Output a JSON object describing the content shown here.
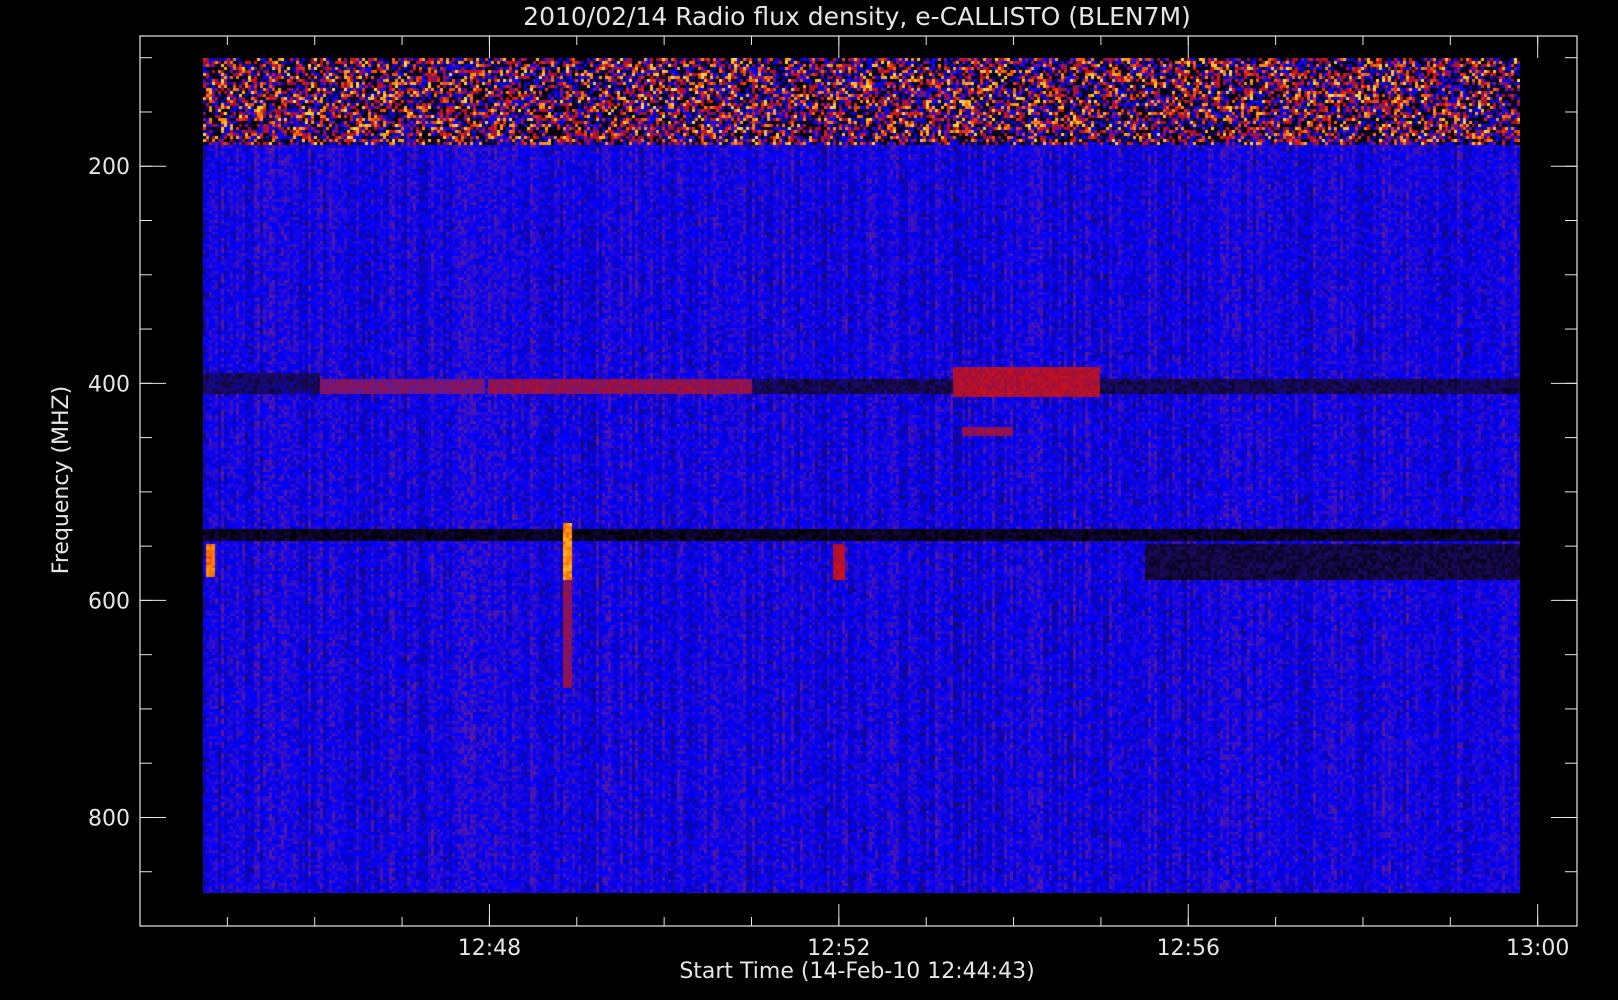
{
  "chart_data": {
    "type": "heatmap",
    "title": "2010/02/14  Radio flux density, e-CALLISTO (BLEN7M)",
    "xlabel": "Start Time (14-Feb-10 12:44:43)",
    "ylabel": "Frequency (MHZ)",
    "x_unit": "minutes after 12:00",
    "xlim": [
      44.0,
      60.45
    ],
    "ylim": [
      900,
      80
    ],
    "data_x_range": [
      44.72,
      59.8
    ],
    "data_y_range": [
      100,
      870
    ],
    "x_ticks": [
      {
        "value": 48,
        "label": "12:48"
      },
      {
        "value": 52,
        "label": "12:52"
      },
      {
        "value": 56,
        "label": "12:56"
      },
      {
        "value": 60,
        "label": "13:00"
      }
    ],
    "x_minor_step": 1,
    "y_ticks": [
      {
        "value": 200,
        "label": "200"
      },
      {
        "value": 400,
        "label": "400"
      },
      {
        "value": 600,
        "label": "600"
      },
      {
        "value": 800,
        "label": "800"
      }
    ],
    "y_minor_step": 50,
    "colormap": [
      "#000000",
      "#1a0a5a",
      "#0000ff",
      "#5a1aa0",
      "#9a1040",
      "#d81010",
      "#ff7a00",
      "#ffe040"
    ],
    "background_intensity": 0.3,
    "features": [
      {
        "kind": "interference_band",
        "freq_range": [
          100,
          180
        ],
        "intensity": 0.85
      },
      {
        "kind": "band",
        "freq_range": [
          390,
          410
        ],
        "time_range": [
          44.72,
          46.05
        ],
        "intensity": 0.15
      },
      {
        "kind": "band",
        "freq_range": [
          395,
          410
        ],
        "time_range": [
          46.05,
          47.95
        ],
        "intensity": 0.5
      },
      {
        "kind": "band",
        "freq_range": [
          395,
          410
        ],
        "time_range": [
          48.0,
          51.0
        ],
        "intensity": 0.55
      },
      {
        "kind": "band",
        "freq_range": [
          395,
          410
        ],
        "time_range": [
          51.0,
          53.3
        ],
        "intensity": 0.12
      },
      {
        "kind": "band",
        "freq_range": [
          385,
          412
        ],
        "time_range": [
          53.3,
          55.0
        ],
        "intensity": 0.62
      },
      {
        "kind": "band",
        "freq_range": [
          395,
          410
        ],
        "time_range": [
          55.0,
          59.8
        ],
        "intensity": 0.12
      },
      {
        "kind": "band",
        "freq_range": [
          535,
          545
        ],
        "time_range": [
          44.72,
          59.8
        ],
        "intensity": 0.05
      },
      {
        "kind": "band",
        "freq_range": [
          548,
          580
        ],
        "time_range": [
          55.5,
          59.8
        ],
        "intensity": 0.1
      },
      {
        "kind": "burst",
        "time": 48.9,
        "freq_range": [
          530,
          580
        ],
        "intensity": 0.95
      },
      {
        "kind": "burst",
        "time": 48.9,
        "freq_range": [
          580,
          680
        ],
        "intensity": 0.6
      },
      {
        "kind": "burst",
        "time": 44.8,
        "freq_range": [
          548,
          578
        ],
        "intensity": 0.9
      },
      {
        "kind": "burst",
        "time": 52.0,
        "freq_range": [
          548,
          580
        ],
        "intensity": 0.7
      },
      {
        "kind": "band",
        "freq_range": [
          440,
          448
        ],
        "time_range": [
          53.4,
          54.0
        ],
        "intensity": 0.55
      }
    ]
  }
}
